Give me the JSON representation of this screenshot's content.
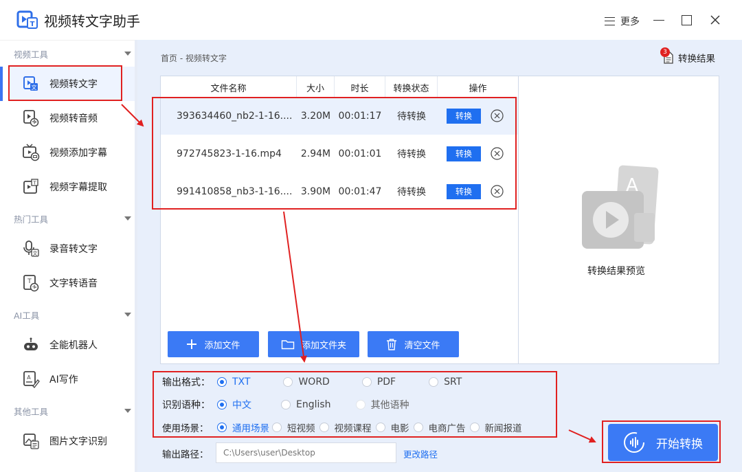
{
  "app": {
    "title": "视频转文字助手",
    "menu_label": "更多"
  },
  "sidebar": {
    "sections": [
      {
        "title": "视频工具",
        "items": [
          {
            "label": "视频转文字",
            "icon": "video-to-text-icon",
            "active": true
          },
          {
            "label": "视频转音频",
            "icon": "video-to-audio-icon"
          },
          {
            "label": "视频添加字幕",
            "icon": "video-subtitle-icon"
          },
          {
            "label": "视频字幕提取",
            "icon": "subtitle-extract-icon"
          }
        ]
      },
      {
        "title": "热门工具",
        "items": [
          {
            "label": "录音转文字",
            "icon": "audio-to-text-icon"
          },
          {
            "label": "文字转语音",
            "icon": "text-to-speech-icon"
          }
        ]
      },
      {
        "title": "AI工具",
        "items": [
          {
            "label": "全能机器人",
            "icon": "robot-icon"
          },
          {
            "label": "AI写作",
            "icon": "ai-write-icon"
          }
        ]
      },
      {
        "title": "其他工具",
        "items": [
          {
            "label": "图片文字识别",
            "icon": "image-ocr-icon"
          }
        ]
      }
    ]
  },
  "breadcrumb": {
    "home": "首页",
    "sep": "-",
    "current": "视频转文字"
  },
  "results": {
    "label": "转换结果",
    "count": "3"
  },
  "table": {
    "headers": [
      "文件名称",
      "大小",
      "时长",
      "转换状态",
      "操作"
    ],
    "rows": [
      {
        "name": "393634460_nb2-1-16....",
        "size": "3.20M",
        "duration": "00:01:17",
        "status": "待转换",
        "action": "转换"
      },
      {
        "name": "972745823-1-16.mp4",
        "size": "2.94M",
        "duration": "00:01:01",
        "status": "待转换",
        "action": "转换"
      },
      {
        "name": "991410858_nb3-1-16....",
        "size": "3.90M",
        "duration": "00:01:47",
        "status": "待转换",
        "action": "转换"
      }
    ]
  },
  "actions": {
    "add_file": "添加文件",
    "add_folder": "添加文件夹",
    "clear": "清空文件"
  },
  "preview": {
    "label": "转换结果预览"
  },
  "options": {
    "format": {
      "label": "输出格式：",
      "choices": [
        "TXT",
        "WORD",
        "PDF",
        "SRT"
      ],
      "selected": "TXT"
    },
    "language": {
      "label": "识别语种：",
      "choices": [
        "中文",
        "English",
        "其他语种"
      ],
      "selected": "中文"
    },
    "scene": {
      "label": "使用场景：",
      "choices": [
        "通用场景",
        "短视频",
        "视频课程",
        "电影",
        "电商广告",
        "新闻报道"
      ],
      "selected": "通用场景"
    }
  },
  "output": {
    "label": "输出路径：",
    "placeholder": "C:\\Users\\user\\Desktop",
    "change_label": "更改路径"
  },
  "start": {
    "label": "开始转换"
  },
  "colors": {
    "accent": "#1f6ff0",
    "button": "#3b7af5",
    "annotation": "#e02020",
    "main_bg": "#e8effb"
  }
}
